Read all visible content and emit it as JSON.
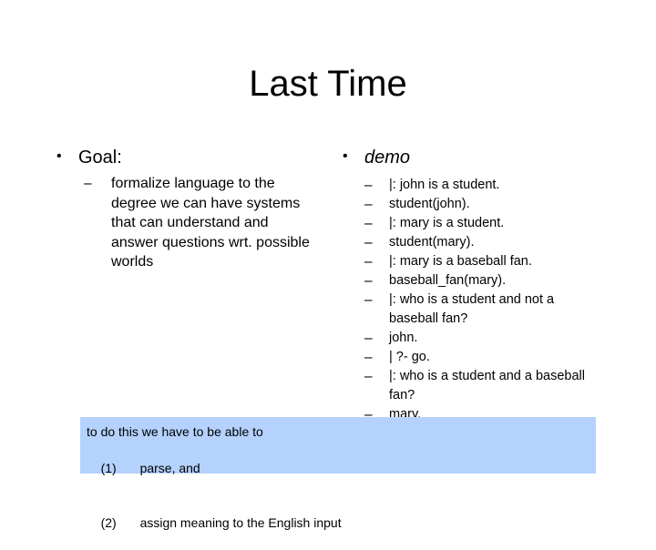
{
  "slide": {
    "title": "Last Time",
    "bullet_marker": "•",
    "dash_marker": "–"
  },
  "left_column": {
    "heading": "Goal:",
    "items": [
      "formalize language to the degree we can have systems that can understand and answer questions wrt. possible worlds"
    ]
  },
  "right_column": {
    "heading": "demo",
    "items": [
      "|: john is a student.",
      "student(john).",
      "|: mary is a student.",
      "student(mary).",
      "|: mary is a baseball fan.",
      "baseball_fan(mary).",
      "|: who is a student and not a baseball fan?",
      "john.",
      "| ?- go.",
      "|: who is a student and a baseball fan?",
      "mary."
    ]
  },
  "note_box": {
    "background_color": "#b4d2fd",
    "intro": "to do this we have to be able to",
    "steps": [
      {
        "number": "(1)",
        "text": "parse, and"
      },
      {
        "number": "(2)",
        "text": "assign meaning to the English input"
      }
    ]
  }
}
